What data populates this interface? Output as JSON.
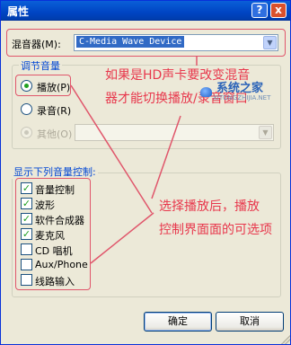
{
  "window": {
    "title": "属性",
    "help_label": "?",
    "close_label": "x"
  },
  "mixer": {
    "label": "混音器(M):",
    "value": "C-Media Wave Device"
  },
  "adjust_group": {
    "title": "调节音量",
    "playback": {
      "label": "播放(P)",
      "selected": true
    },
    "record": {
      "label": "录音(R)",
      "selected": false
    },
    "other": {
      "label": "其他(O)",
      "selected": false,
      "enabled": false
    }
  },
  "controls_group": {
    "title": "显示下列音量控制:",
    "items": [
      {
        "label": "音量控制",
        "checked": true
      },
      {
        "label": "波形",
        "checked": true
      },
      {
        "label": "软件合成器",
        "checked": true
      },
      {
        "label": "麦克风",
        "checked": true
      },
      {
        "label": "CD 唱机",
        "checked": false
      },
      {
        "label": "Aux/Phone",
        "checked": false
      },
      {
        "label": "线路输入",
        "checked": false
      }
    ]
  },
  "buttons": {
    "ok": "确定",
    "cancel": "取消"
  },
  "annotations": {
    "callout1": [
      "如果是HD声卡要改变混音",
      "器才能切换播放/录音窗口"
    ],
    "callout2": [
      "选择播放后，播放",
      "控制界面面的可选项"
    ],
    "watermark": "系统之家",
    "watermark_sub": "XITONGZHIJIA.NET"
  },
  "colors": {
    "annotation": "#e0566b",
    "titlebar": "#0054e3",
    "check": "#21a121"
  },
  "icons": {
    "help": "question-icon",
    "close": "close-x-icon",
    "combo_arrow": "chevron-down-icon"
  }
}
